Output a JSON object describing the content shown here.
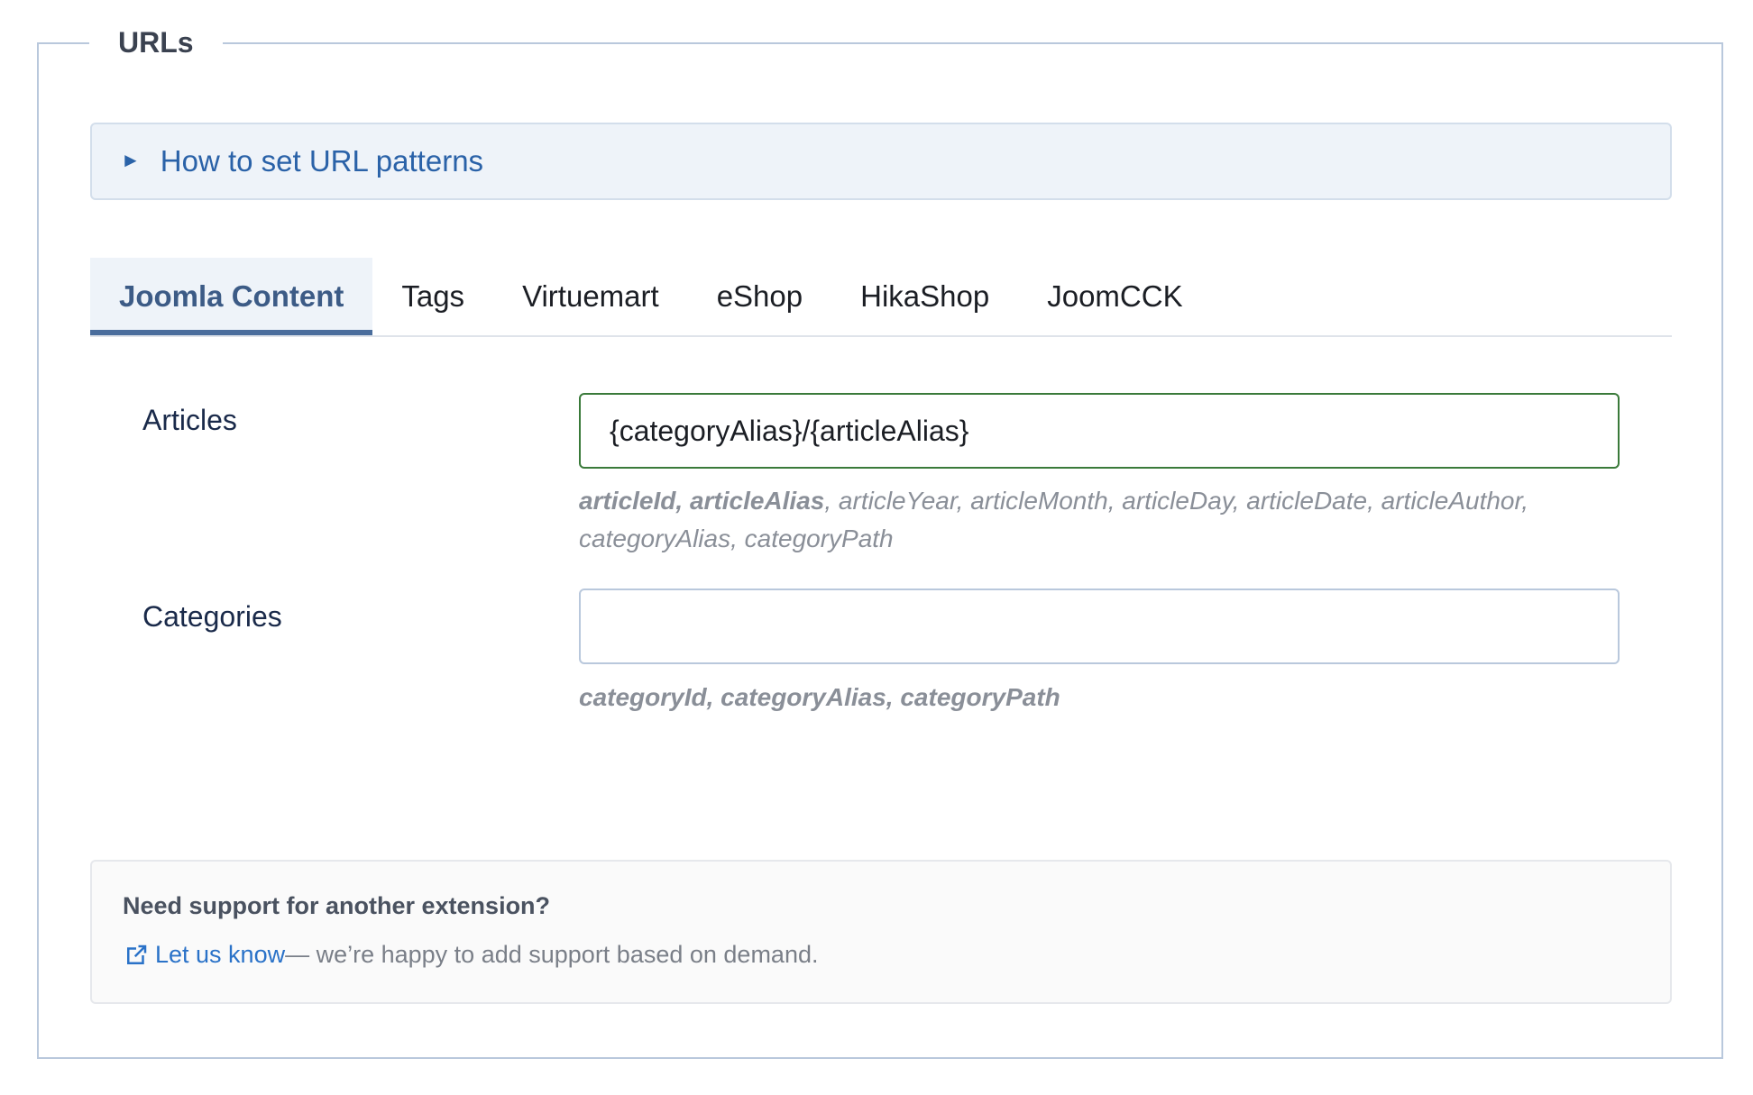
{
  "fieldset": {
    "legend": "URLs"
  },
  "help": {
    "arrow": "►",
    "summary": "How to set URL patterns"
  },
  "tabs": [
    {
      "label": "Joomla Content",
      "active": true
    },
    {
      "label": "Tags",
      "active": false
    },
    {
      "label": "Virtuemart",
      "active": false
    },
    {
      "label": "eShop",
      "active": false
    },
    {
      "label": "HikaShop",
      "active": false
    },
    {
      "label": "JoomCCK",
      "active": false
    }
  ],
  "fields": {
    "articles": {
      "label": "Articles",
      "value": "{categoryAlias}/{articleAlias}",
      "hint_bold": "articleId, articleAlias",
      "hint_rest": ", articleYear, articleMonth, articleDay, articleDate, articleAuthor, categoryAlias, categoryPath"
    },
    "categories": {
      "label": "Categories",
      "value": "",
      "hint_bold": "categoryId, categoryAlias, categoryPath"
    }
  },
  "support": {
    "title": "Need support for another extension?",
    "link_label": "Let us know",
    "text": " — we’re happy to add support based on demand.",
    "icon": "external-link-icon"
  },
  "colors": {
    "accent": "#2a62a8",
    "active_tab": "#3c5b86",
    "focus_border": "#3a7a3a"
  }
}
